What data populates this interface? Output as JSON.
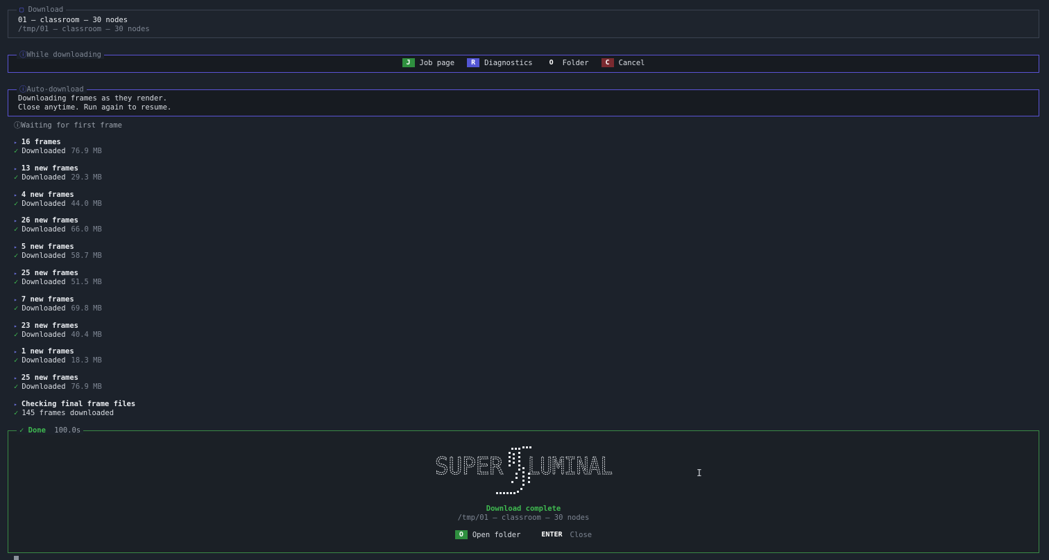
{
  "download": {
    "legend_icon": "▢",
    "legend": "Download",
    "title": "01 — classroom — 30 nodes",
    "path": "/tmp/01 — classroom — 30 nodes"
  },
  "while_downloading": {
    "legend_icon": "ⓘ",
    "legend": "While downloading",
    "actions": [
      {
        "key": "J",
        "label": "Job page",
        "color": "#2f8f3f"
      },
      {
        "key": "R",
        "label": "Diagnostics",
        "color": "#5356d4"
      },
      {
        "key": "O",
        "label": "Folder",
        "color": "transparent"
      },
      {
        "key": "C",
        "label": "Cancel",
        "color": "#7a2a30"
      }
    ]
  },
  "auto_download": {
    "legend_icon": "ⓘ",
    "legend": "Auto-download",
    "line1": "Downloading frames as they render.",
    "line2": "Close anytime. Run again to resume."
  },
  "waiting": "ⓘWaiting for first frame",
  "steps": [
    {
      "title": "16 frames",
      "status": "Downloaded",
      "size": "76.9 MB"
    },
    {
      "title": "13 new frames",
      "status": "Downloaded",
      "size": "29.3 MB"
    },
    {
      "title": "4 new frames",
      "status": "Downloaded",
      "size": "44.0 MB"
    },
    {
      "title": "26 new frames",
      "status": "Downloaded",
      "size": "66.0 MB"
    },
    {
      "title": "5 new frames",
      "status": "Downloaded",
      "size": "58.7 MB"
    },
    {
      "title": "25 new frames",
      "status": "Downloaded",
      "size": "51.5 MB"
    },
    {
      "title": "7 new frames",
      "status": "Downloaded",
      "size": "69.8 MB"
    },
    {
      "title": "23 new frames",
      "status": "Downloaded",
      "size": "40.4 MB"
    },
    {
      "title": "1 new frames",
      "status": "Downloaded",
      "size": "18.3 MB"
    },
    {
      "title": "25 new frames",
      "status": "Downloaded",
      "size": "76.9 MB"
    },
    {
      "title": "Checking final frame files",
      "status": "145 frames downloaded",
      "size": ""
    }
  ],
  "done": {
    "legend": "✓ Done",
    "time": "100.0s",
    "logo_text": "SUPER LUMINAL",
    "message": "Download complete",
    "path": "/tmp/01 — classroom — 30 nodes",
    "open_key": "O",
    "open_label": "Open folder",
    "close_key": "ENTER",
    "close_label": "Close"
  },
  "colors": {
    "accent_purple": "#5b54d6",
    "success_green": "#3fb950",
    "background": "#1c222b"
  }
}
